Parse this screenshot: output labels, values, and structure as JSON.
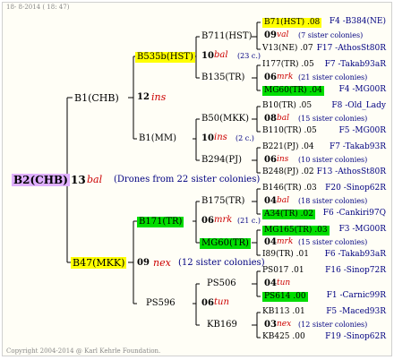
{
  "header": {
    "date": "18-  8-2014 ( 18: 47)"
  },
  "footer": {
    "copyright": "Copyright 2004-2014 @ Karl Kehrle Foundation."
  },
  "root": {
    "name": "B2(CHB)",
    "gen": "13",
    "tag": "bal",
    "note": "(Drones from 22 sister colonies)"
  },
  "level1": [
    {
      "name": "B1(CHB)",
      "gen": "12",
      "tag": "ins"
    },
    {
      "name": "B47(MKK)",
      "gen": "09",
      "tag": "nex",
      "note": "(12 sister colonies)"
    }
  ],
  "level2": [
    {
      "name": "B535b(HST)",
      "gen": "10",
      "tag": "bal",
      "note": "(23 c.)"
    },
    {
      "name": "B1(MM)",
      "gen": "10",
      "tag": "ins",
      "note": "(2 c.)"
    },
    {
      "name": "B171(TR)",
      "gen": "06",
      "tag": "mrk",
      "note": "(21 c.)"
    },
    {
      "name": "PS596",
      "gen": "06",
      "tag": "tun"
    }
  ],
  "level3": [
    {
      "name": "B711(HST)"
    },
    {
      "name": "B135(TR)"
    },
    {
      "name": "B50(MKK)"
    },
    {
      "name": "B294(PJ)"
    },
    {
      "name": "B175(TR)"
    },
    {
      "name": "MG60(TR)"
    },
    {
      "name": "PS506"
    },
    {
      "name": "KB169"
    }
  ],
  "level4": [
    {
      "left": "B71(HST) .08",
      "right": "F4 -B384(NE)"
    },
    {
      "gen": "09",
      "tag": "val",
      "note": "(7 sister colonies)"
    },
    {
      "left": "V13(NE) .07",
      "right": "F17 -AthosSt80R"
    },
    {
      "left": "I177(TR) .05",
      "right": "F7 -Takab93aR"
    },
    {
      "gen": "06",
      "tag": "mrk",
      "note": "(21 sister colonies)"
    },
    {
      "left": "MG60(TR) .04",
      "right": "F4 -MG00R"
    },
    {
      "left": "B10(TR) .05",
      "right": "F8 -Old_Lady"
    },
    {
      "gen": "08",
      "tag": "bal",
      "note": "(15 sister colonies)"
    },
    {
      "left": "B110(TR) .05",
      "right": "F5 -MG00R"
    },
    {
      "left": "B221(PJ) .04",
      "right": "F7 -Takab93R"
    },
    {
      "gen": "06",
      "tag": "ins",
      "note": "(10 sister colonies)"
    },
    {
      "left": "B248(PJ) .02",
      "right": "F13 -AthosSt80R"
    },
    {
      "left": "B146(TR) .03",
      "right": "F20 -Sinop62R"
    },
    {
      "gen": "04",
      "tag": "bal",
      "note": "(18 sister colonies)"
    },
    {
      "left": "A34(TR) .02",
      "right": "F6 -Cankiri97Q"
    },
    {
      "left": "MG165(TR) .03",
      "right": "F3 -MG00R"
    },
    {
      "gen": "04",
      "tag": "mrk",
      "note": "(15 sister colonies)"
    },
    {
      "left": "I89(TR) .01",
      "right": "F6 -Takab93aR"
    },
    {
      "left": "PS017 .01",
      "right": "F16 -Sinop72R"
    },
    {
      "gen": "04",
      "tag": "tun"
    },
    {
      "left": "PS614 .00",
      "right": "F1 -Carnic99R"
    },
    {
      "left": "KB113 .01",
      "right": "F5 -Maced93R"
    },
    {
      "gen": "03",
      "tag": "nex",
      "note": "(12 sister colonies)"
    },
    {
      "left": "KB425 .00",
      "right": "F19 -Sinop62R"
    }
  ]
}
